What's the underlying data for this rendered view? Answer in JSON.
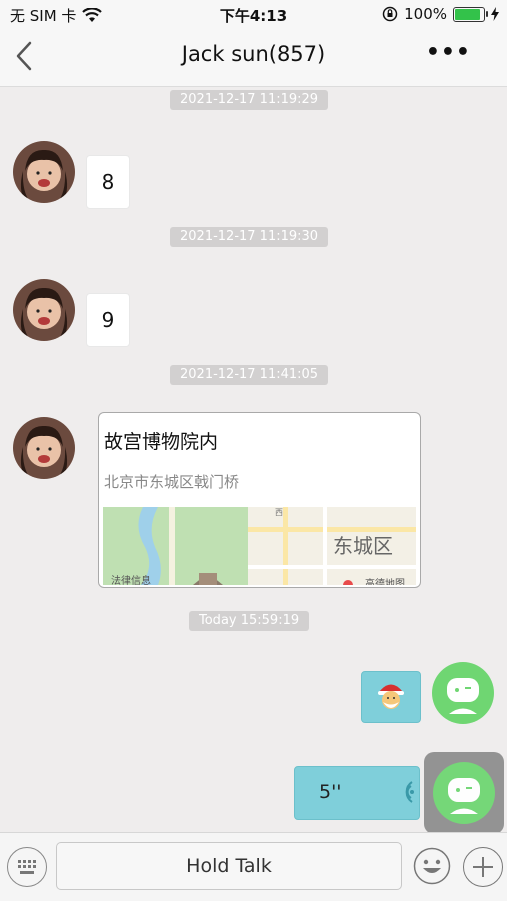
{
  "status_bar": {
    "carrier": "无 SIM 卡",
    "time": "下午4:13",
    "battery_percent": "100%",
    "battery_level": 1.0,
    "icons": [
      "wifi-icon",
      "orientation-lock-icon",
      "battery-icon",
      "charging-icon"
    ]
  },
  "nav": {
    "title": "Jack sun(857)",
    "more": "•••",
    "icons": [
      "back-chevron-icon",
      "more-icon"
    ]
  },
  "messages": [
    {
      "type": "timestamp",
      "text": "2021-12-17 11:19:29"
    },
    {
      "type": "received_text",
      "text": "8"
    },
    {
      "type": "timestamp",
      "text": "2021-12-17 11:19:30"
    },
    {
      "type": "received_text",
      "text": "9"
    },
    {
      "type": "timestamp",
      "text": "2021-12-17 11:41:05"
    },
    {
      "type": "received_location",
      "name": "故宫博物院内",
      "address": "北京市东城区戟门桥",
      "map_labels": {
        "district": "东城区",
        "legal": "法律信息",
        "road": "西",
        "provider": "高德地图"
      }
    },
    {
      "type": "timestamp",
      "text": "Today 15:59:19"
    },
    {
      "type": "sent_emoji",
      "icon": "santa-emoji-icon"
    },
    {
      "type": "sent_voice",
      "duration": "5''",
      "icon": "voice-wave-icon"
    }
  ],
  "input_bar": {
    "hold_talk_label": "Hold Talk",
    "icons": [
      "keyboard-icon",
      "emoji-icon",
      "plus-icon"
    ]
  },
  "colors": {
    "sent_bubble": "#7fcfda",
    "self_avatar": "#6fd672",
    "timestamp_bg": "#d2d0d0",
    "chat_bg": "#efeded"
  }
}
